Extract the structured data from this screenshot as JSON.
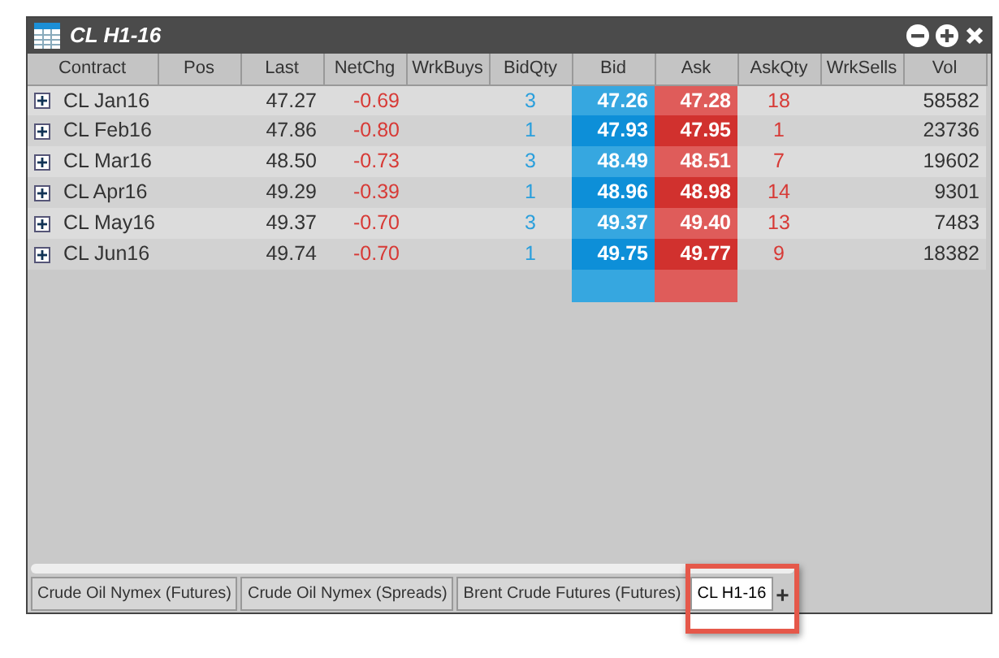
{
  "window": {
    "title": "CL H1-16"
  },
  "table": {
    "columns": [
      "Contract",
      "Pos",
      "Last",
      "NetChg",
      "WrkBuys",
      "BidQty",
      "Bid",
      "Ask",
      "AskQty",
      "WrkSells",
      "Vol"
    ],
    "rows": [
      {
        "expanded": false,
        "contract": "CL Jan16",
        "last": "47.27",
        "netchg": "-0.69",
        "bidqty": "3",
        "bid": "47.26",
        "ask": "47.28",
        "askqty": "18",
        "vol": "58582"
      },
      {
        "expanded": false,
        "contract": "CL Feb16",
        "last": "47.86",
        "netchg": "-0.80",
        "bidqty": "1",
        "bid": "47.93",
        "ask": "47.95",
        "askqty": "1",
        "vol": "23736"
      },
      {
        "expanded": false,
        "contract": "CL Mar16",
        "last": "48.50",
        "netchg": "-0.73",
        "bidqty": "3",
        "bid": "48.49",
        "ask": "48.51",
        "askqty": "7",
        "vol": "19602"
      },
      {
        "expanded": false,
        "contract": "CL Apr16",
        "last": "49.29",
        "netchg": "-0.39",
        "bidqty": "1",
        "bid": "48.96",
        "ask": "48.98",
        "askqty": "14",
        "vol": "9301"
      },
      {
        "expanded": false,
        "contract": "CL May16",
        "last": "49.37",
        "netchg": "-0.70",
        "bidqty": "3",
        "bid": "49.37",
        "ask": "49.40",
        "askqty": "13",
        "vol": "7483"
      },
      {
        "expanded": false,
        "contract": "CL Jun16",
        "last": "49.74",
        "netchg": "-0.70",
        "bidqty": "1",
        "bid": "49.75",
        "ask": "49.77",
        "askqty": "9",
        "vol": "18382"
      }
    ]
  },
  "tabs": [
    {
      "label": "Crude Oil Nymex (Futures)",
      "selected": false
    },
    {
      "label": "Crude Oil Nymex (Spreads)",
      "selected": false
    },
    {
      "label": "Brent Crude Futures (Futures)",
      "selected": false
    },
    {
      "label": "CL H1-16",
      "selected": true
    }
  ],
  "add_tab": "+"
}
